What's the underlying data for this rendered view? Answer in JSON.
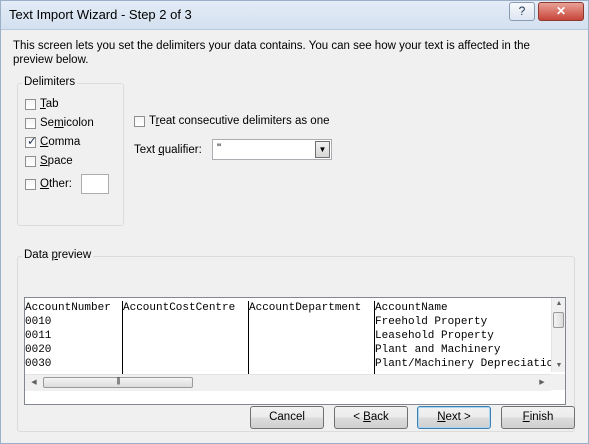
{
  "window": {
    "title": "Text Import Wizard - Step 2 of 3",
    "help_label": "?",
    "close_label": "✕"
  },
  "intro_text": "This screen lets you set the delimiters your data contains.  You can see how your text is affected in the preview below.",
  "delimiters": {
    "label": "Delimiters",
    "tab": {
      "underline": "T",
      "rest": "ab",
      "checked": false
    },
    "semicolon": {
      "pre": "Se",
      "underline": "m",
      "rest": "icolon",
      "checked": false
    },
    "comma": {
      "underline": "C",
      "rest": "omma",
      "checked": true
    },
    "space": {
      "underline": "S",
      "rest": "pace",
      "checked": false
    },
    "other": {
      "underline": "O",
      "rest": "ther:",
      "checked": false,
      "value": ""
    }
  },
  "options": {
    "consecutive": {
      "pre": "T",
      "underline": "r",
      "rest": "eat consecutive delimiters as one",
      "checked": false
    },
    "qualifier": {
      "pre": "Text ",
      "underline": "q",
      "rest": "ualifier:",
      "value": "\""
    }
  },
  "preview": {
    "label_pre": "Data ",
    "label_underline": "p",
    "label_rest": "review",
    "columns": [
      {
        "header": "AccountNumber",
        "cells": [
          "0010",
          "0011",
          "0020",
          "0030"
        ]
      },
      {
        "header": "AccountCostCentre",
        "cells": [
          "",
          "",
          "",
          ""
        ]
      },
      {
        "header": "AccountDepartment",
        "cells": [
          "",
          "",
          "",
          ""
        ]
      },
      {
        "header": "AccountName",
        "cells": [
          "Freehold Property",
          "Leasehold Property",
          "Plant and Machinery",
          "Plant/Machinery Depreciation"
        ]
      }
    ]
  },
  "buttons": {
    "cancel": "Cancel",
    "back": {
      "pre": "< ",
      "underline": "B",
      "rest": "ack"
    },
    "next": {
      "underline": "N",
      "rest": "ext >"
    },
    "finish": {
      "underline": "F",
      "rest": "inish"
    }
  }
}
